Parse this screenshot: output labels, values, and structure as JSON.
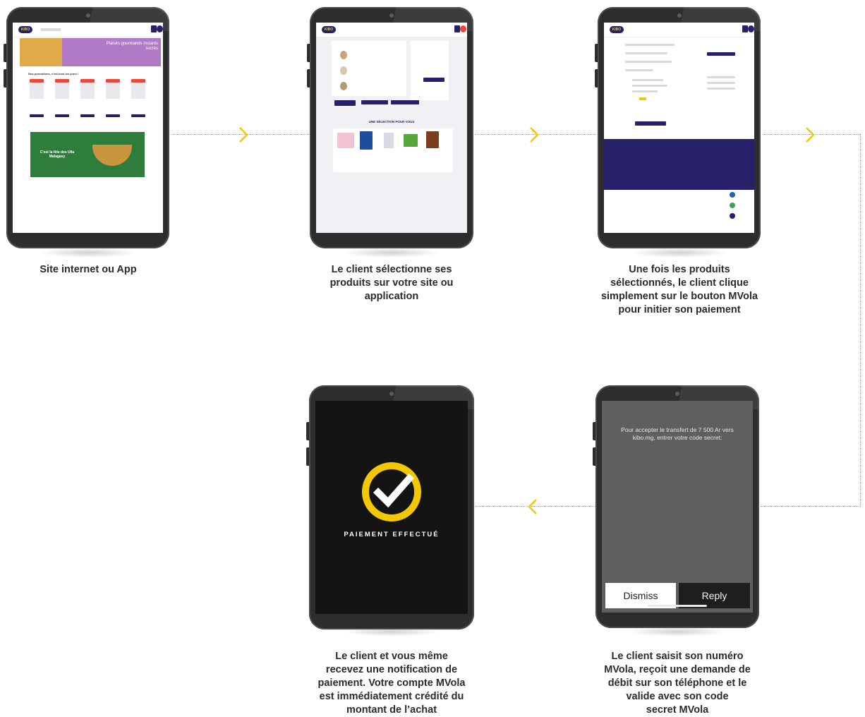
{
  "steps": [
    {
      "caption": [
        "Site internet ou App"
      ]
    },
    {
      "caption": [
        "Le client sélectionne ses",
        "produits sur votre site ou",
        "application"
      ]
    },
    {
      "caption": [
        "Une fois les produits",
        "sélectionnés, le client clique",
        "simplement sur le bouton MVola",
        "pour initier son paiement"
      ]
    },
    {
      "caption": [
        "Le client saisit son numéro",
        "MVola, reçoit une demande de",
        "débit sur son téléphone et le",
        "valide avec son code",
        "secret MVola"
      ]
    },
    {
      "caption": [
        "Le client et vous même",
        "recevez une notification de",
        "paiement. Votre compte MVola",
        "est immédiatement crédité du",
        "montant de l’achat"
      ]
    }
  ],
  "notification": {
    "message": "Pour accepter le transfert de 7 500 Ar vers kibo.mg, entrer votre code secret:",
    "dismiss_label": "Dismiss",
    "reply_label": "Reply"
  },
  "success": {
    "label": "PAIEMENT EFFECTUÉ"
  },
  "site": {
    "logo_text": "KIBO",
    "banner_text": "Plaisirs gourmands instants sucrés",
    "promo_heading": "Nos promotions, c'est tous les jours !",
    "banner2_text": "C'est la fête des Ulla Malagasy",
    "selection_heading": "UNE SÉLECTION POUR VOUS"
  },
  "colors": {
    "accent": "#f3c800",
    "brand": "#26206b",
    "connector": "#9a9a9a",
    "caption": "#2b2b2b"
  }
}
